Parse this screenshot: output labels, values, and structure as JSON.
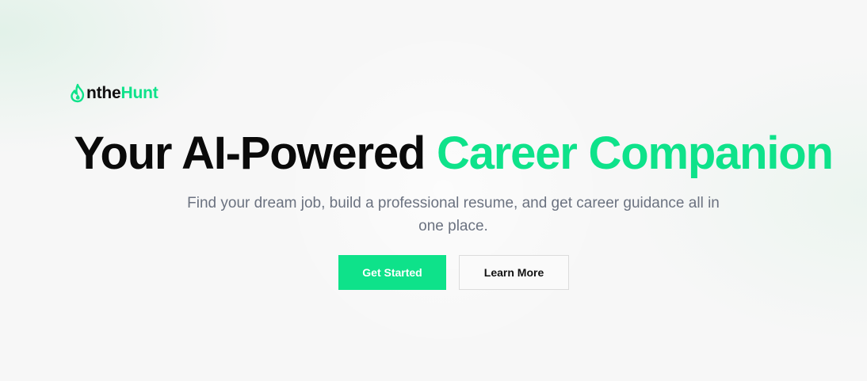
{
  "brand": {
    "logo_prefix": "nthe",
    "logo_suffix": "Hunt",
    "accent_color": "#0ee28a"
  },
  "hero": {
    "title_dark": "Your AI-Powered ",
    "title_green": "Career Companion",
    "subtitle": "Find your dream job, build a professional resume, and get career guidance all in one place."
  },
  "actions": {
    "primary_label": "Get Started",
    "secondary_label": "Learn More"
  },
  "icons": {
    "logo_icon": "flame-icon"
  }
}
